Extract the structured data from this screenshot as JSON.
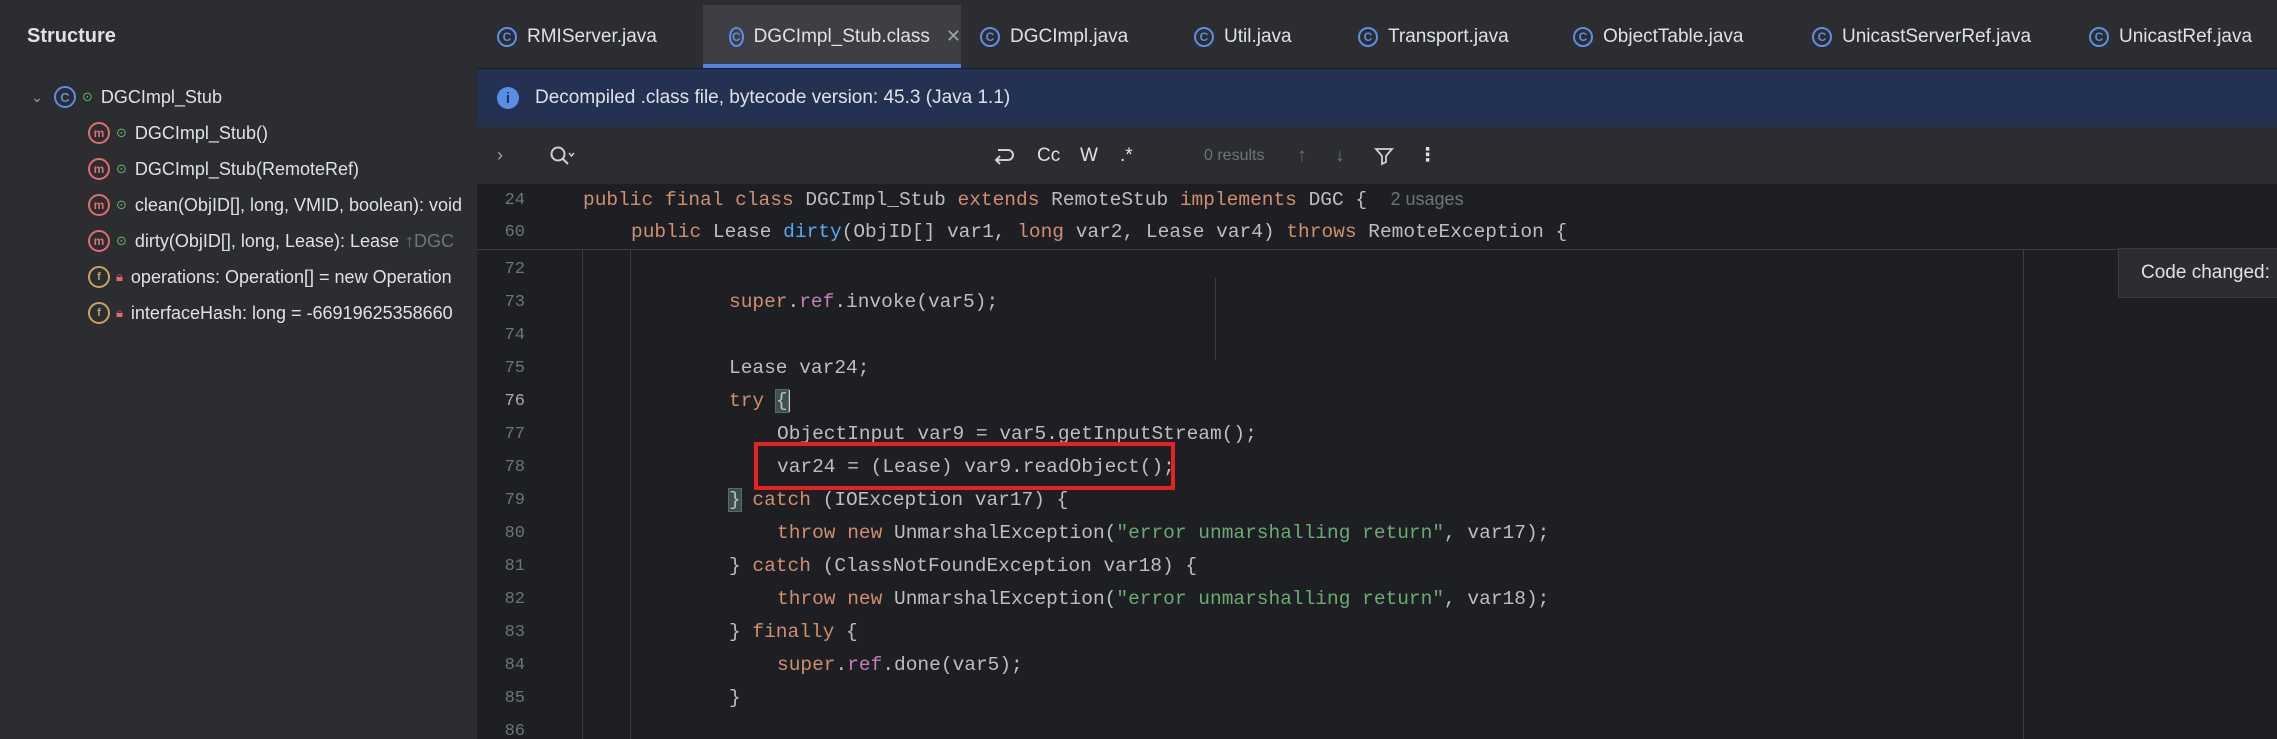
{
  "structure": {
    "title": "Structure",
    "root": "DGCImpl_Stub",
    "items": [
      {
        "label": "DGCImpl_Stub()",
        "suffix": "",
        "kind": "method",
        "visibility": "public"
      },
      {
        "label": "DGCImpl_Stub(RemoteRef)",
        "suffix": "",
        "kind": "method",
        "visibility": "public"
      },
      {
        "label": "clean(ObjID[], long, VMID, boolean): void",
        "suffix": "",
        "kind": "method",
        "visibility": "public"
      },
      {
        "label": "dirty(ObjID[], long, Lease): Lease",
        "suffix": "↑DGC",
        "kind": "method",
        "visibility": "public"
      },
      {
        "label": "operations: Operation[] = new Operation",
        "suffix": "",
        "kind": "field",
        "visibility": "private"
      },
      {
        "label": "interfaceHash: long = -66919625358660",
        "suffix": "",
        "kind": "field",
        "visibility": "private"
      }
    ]
  },
  "tabs": [
    {
      "label": "RMIServer.java",
      "active": false
    },
    {
      "label": "DGCImpl_Stub.class",
      "active": true
    },
    {
      "label": "DGCImpl.java",
      "active": false
    },
    {
      "label": "Util.java",
      "active": false
    },
    {
      "label": "Transport.java",
      "active": false
    },
    {
      "label": "ObjectTable.java",
      "active": false
    },
    {
      "label": "UnicastServerRef.java",
      "active": false
    },
    {
      "label": "UnicastRef.java",
      "active": false
    }
  ],
  "banner": {
    "text": "Decompiled .class file, bytecode version: 45.3 (Java 1.1)"
  },
  "search": {
    "results": "0 results",
    "match_case": "Cc",
    "words": "W",
    "regex": ".*"
  },
  "sticky": [
    {
      "line": "24",
      "usages": "2 usages"
    },
    {
      "line": "60"
    }
  ],
  "lines": [
    "72",
    "73",
    "74",
    "75",
    "76",
    "77",
    "78",
    "79",
    "80",
    "81",
    "82",
    "83",
    "84",
    "85",
    "86"
  ],
  "current_line": "76",
  "code": {
    "l24": {
      "public": "public",
      "final": "final",
      "class": "class",
      "name": "DGCImpl_Stub",
      "extends": "extends",
      "parent": "RemoteStub",
      "implements": "implements",
      "iface": "DGC {"
    },
    "l60": {
      "public": "public",
      "type": "Lease",
      "method": "dirty",
      "sig1": "(ObjID[] var1, ",
      "long": "long",
      "sig2": " var2, Lease var4) ",
      "throws": "throws",
      "exc": " RemoteException {"
    },
    "l73": {
      "super": "super",
      "dot": ".",
      "ref": "ref",
      "rest": ".invoke(var5);"
    },
    "l75": "Lease var24;",
    "l76": {
      "try": "try",
      "brace": "{"
    },
    "l77": "ObjectInput var9 = var5.getInputStream();",
    "l78": "var24 = (Lease) var9.readObject();",
    "l79": {
      "close": "}",
      "catch": "catch",
      "rest": " (IOException var17) {"
    },
    "l80": {
      "throw": "throw",
      "new": "new",
      "mid": " UnmarshalException(",
      "str": "\"error unmarshalling return\"",
      "end": ", var17);"
    },
    "l81": {
      "close": "} ",
      "catch": "catch",
      "rest": " (ClassNotFoundException var18) {"
    },
    "l82": {
      "throw": "throw",
      "new": "new",
      "mid": " UnmarshalException(",
      "str": "\"error unmarshalling return\"",
      "end": ", var18);"
    },
    "l83": {
      "close": "} ",
      "finally": "finally",
      "rest": " {"
    },
    "l84": {
      "super": "super",
      "ref": "ref",
      "rest": ".done(var5);"
    },
    "l85": "}"
  },
  "popup": "Code changed:",
  "colors": {
    "accent": "#4e82e8",
    "highlight_box": "#e5221d",
    "banner_bg": "#233152"
  }
}
